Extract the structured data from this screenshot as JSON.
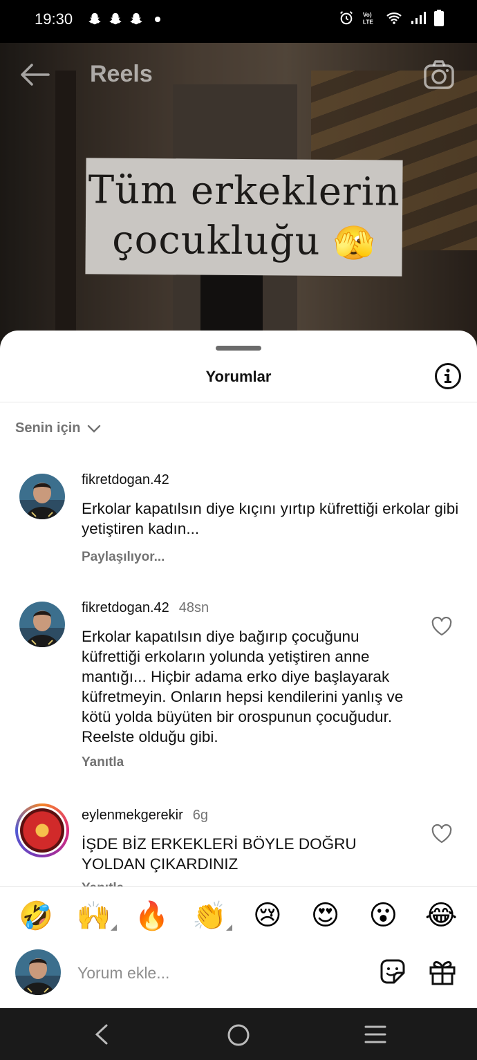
{
  "status_bar": {
    "time": "19:30",
    "left_icons": [
      "snapchat-icon",
      "snapchat-icon",
      "snapchat-icon",
      "dot-icon"
    ],
    "right_icons": [
      "alarm-icon",
      "volte-icon",
      "wifi-icon",
      "signal-icon",
      "battery-icon"
    ]
  },
  "header": {
    "title": "Reels",
    "back_icon": "back-arrow-icon",
    "camera_icon": "camera-icon"
  },
  "video": {
    "caption_line1": "Tüm erkeklerin",
    "caption_line2": "çocukluğu",
    "caption_emoji": "🫣"
  },
  "sheet": {
    "title": "Yorumlar",
    "sort_label": "Senin için"
  },
  "comments": [
    {
      "username": "fikretdogan.42",
      "time": "",
      "text": "Erkolar kapatılsın diye kıçını yırtıp küfrettiği erkolar gibi yetiştiren kadın...",
      "meta": "Paylaşılıyor..."
    },
    {
      "username": "fikretdogan.42",
      "time": "48sn",
      "text": "Erkolar kapatılsın diye bağırıp çocuğunu küfrettiği erkoların yolunda yetiştiren anne mantığı... Hiçbir adama erko diye başlayarak küfretmeyin. Onların hepsi kendilerini yanlış ve kötü yolda büyüten bir orospunun çocuğudur. Reelste olduğu gibi.",
      "meta": "Yanıtla"
    },
    {
      "username": "eylenmekgerekir",
      "time": "6g",
      "text": "İŞDE BİZ ERKEKLERİ BÖYLE DOĞRU YOLDAN ÇIKARDINIZ",
      "meta": "Yanıtla"
    }
  ],
  "emoji_bar": [
    "🤣",
    "🙌",
    "🔥",
    "👏",
    "😢",
    "😍",
    "😮",
    "😂"
  ],
  "composer": {
    "placeholder": "Yorum ekle...",
    "value": ""
  }
}
